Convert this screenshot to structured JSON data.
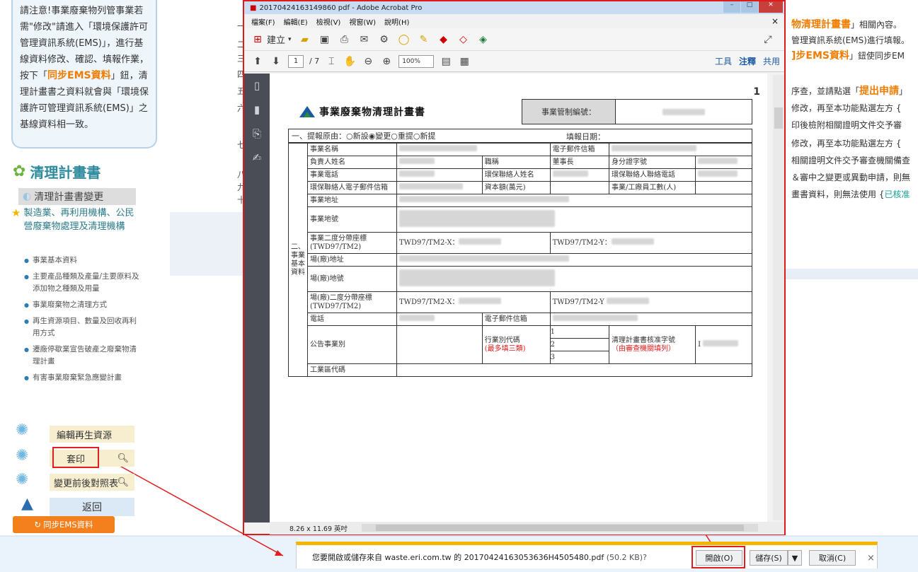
{
  "sidebar": {
    "notice": {
      "text1": "請注意!事業廢棄物列管事業若需\"修改\"請進入「環境保護許可管理資訊系統(EMS)」，進行基線資料修改、確認、填報作業，按下「",
      "highlight": "同步EMS資料",
      "text2": "」鈕，清理計畫書之資料就會與「環境保護許可管理資訊系統(EMS)」之基線資料相一致。"
    },
    "section_title": "清理計畫書",
    "plan_change": "清理計畫書變更",
    "category": "製造業、再利用機構、公民營廢棄物處理及清理機構",
    "sub_items": [
      "事業基本資料",
      "主要產品種類及產量/主要原料及添加物之種類及用量",
      "事業廢棄物之清理方式",
      "再生資源項目、數量及回收再利用方式",
      "遷廠停歇業宣告破產之廢棄物清理計畫",
      "有害事業廢棄緊急應變計畫"
    ],
    "edit_recycle": "編輯再生資源",
    "print": "套印",
    "compare": "變更前後對照表",
    "back": "返回",
    "sync_btn": "同步EMS資料"
  },
  "right_panel": {
    "l1a": "物清理計畫書",
    "l1b": "」相關內容。",
    "l2": "管理資訊系統(EMS)進行填報。",
    "l3a": "]步EMS資料",
    "l3b": "」鈕使同步EM",
    "l4a": "序查，並請點選「",
    "l4b": "提出申請",
    "l4c": "」",
    "l5": "修改，再至本功能點選左方 {",
    "l6": "印後檢附相關證明文件交予審",
    "l7": "修改，再至本功能點選左方 {",
    "l8": "相關證明文件交予審查機關備查",
    "l9": "＆審中之變更或異動申請，則無",
    "l10a": "畫書資料，則無法使用 {",
    "l10b": "已核准"
  },
  "left_marks": [
    "一",
    "二",
    "三",
    "四",
    "五",
    "六",
    "七",
    "八",
    "九",
    "十"
  ],
  "acrobat": {
    "title": "20170424163149860             pdf - Adobe Acrobat Pro",
    "menu": [
      "檔案(F)",
      "編輯(E)",
      "檢視(V)",
      "視窗(W)",
      "說明(H)"
    ],
    "create_label": "建立",
    "page_current": "1",
    "page_total": "/ 7",
    "zoom": "100%",
    "tools": "工具",
    "comment": "注釋",
    "share": "共用",
    "page_size": "8.26 x 11.69 英吋",
    "page_num_right": "1"
  },
  "form": {
    "title": "事業廢棄物清理計畫書",
    "control_label": "事業管制編號：",
    "reason_label": "一、提報原由：",
    "options": [
      "新設",
      "變更",
      "重提",
      "新提"
    ],
    "selected_option": "變更",
    "fill_date": "填報日期：",
    "section2": "二、事業基本資料",
    "labels": {
      "name": "事業名稱",
      "email": "電子郵件信箱",
      "owner": "負責人姓名",
      "title": "職稱",
      "title_val": "董事長",
      "id": "身分證字號",
      "phone": "事業電話",
      "env_contact": "環保聯絡人姓名",
      "env_phone": "環保聯絡人聯絡電話",
      "env_email": "環保聯絡人電子郵件信箱",
      "capital": "資本額(萬元)",
      "employees": "事業/工廠員工數(人)",
      "address": "事業地址",
      "lot": "事業地號",
      "coord": "事業二度分帶座標(TWD97/TM2)",
      "twd_x": "TWD97/TM2-X：",
      "twd_y": "TWD97/TM2-Y：",
      "fac_address": "場(廠)地址",
      "fac_lot": "場(廠)地號",
      "fac_coord": "場(廠)二度分帶座標(TWD97/TM2)",
      "fac_twd_y": "TWD97/TM2-Y",
      "tel": "電話",
      "tel_email": "電子郵件信箱",
      "business": "公告事業別",
      "industry_code": "行業別代碼",
      "industry_note": "(最多填三類)",
      "approval": "清理計畫書核准字號",
      "approval_note": "（由審查機關填列）",
      "zone_code": "工業區代碼",
      "n1": "1",
      "n2": "2",
      "n3": "3",
      "approval_prefix": "I"
    }
  },
  "download_bar": {
    "message_prefix": "您要開啟或儲存來自 waste.eri.com.tw 的 ",
    "filename": "20170424163053636H4505480.pdf",
    "size": " (50.2 KB)?",
    "open": "開啟(O)",
    "save": "儲存(S)",
    "cancel": "取消(C)",
    "close": "×"
  },
  "colors": {
    "accent_orange": "#f07d00",
    "highlight_red": "#e01a1a",
    "teal": "#2e8b9e",
    "download_bar_border": "#f5b400"
  }
}
